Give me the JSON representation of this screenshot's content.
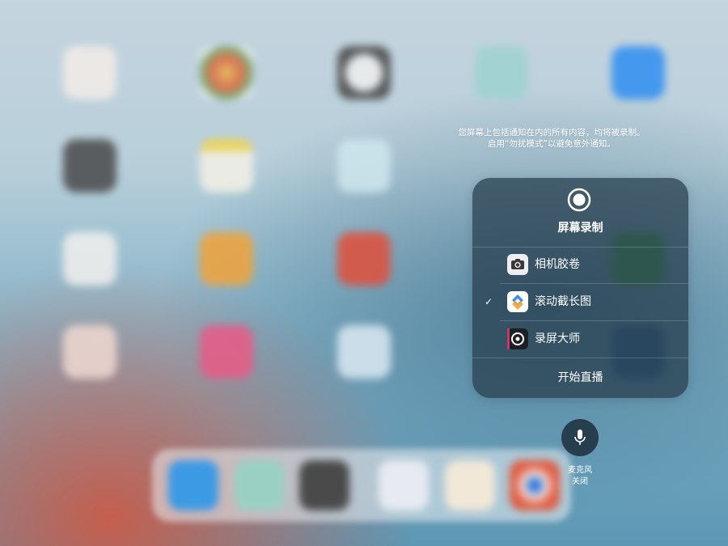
{
  "notice": {
    "line1": "您屏幕上包括通知在内的所有内容，均将被录制。",
    "line2": "启用“勿扰模式”以避免意外通知。"
  },
  "panel": {
    "title": "屏幕录制",
    "items": [
      {
        "label": "相机胶卷",
        "icon": "camera-roll-icon",
        "selected": false,
        "check": ""
      },
      {
        "label": "滚动截长图",
        "icon": "scroll-screenshot-icon",
        "selected": true,
        "check": "✓"
      },
      {
        "label": "录屏大师",
        "icon": "screen-recorder-icon",
        "selected": false,
        "check": ""
      }
    ],
    "start_live": "开始直播"
  },
  "microphone": {
    "label": "麦克风",
    "status": "关闭"
  },
  "colors": {
    "panel_bg": "#263c4b",
    "text": "#ffffff",
    "mic_bg": "#203442"
  }
}
